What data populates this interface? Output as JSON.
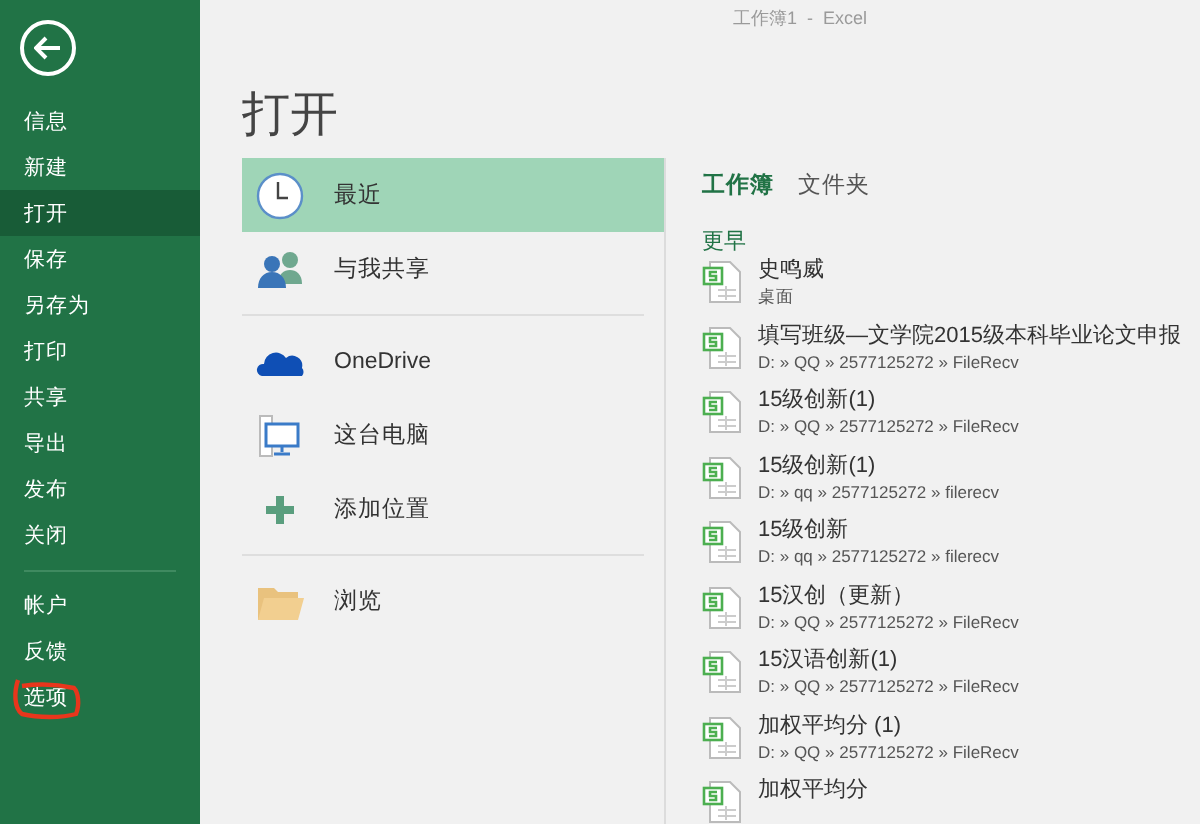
{
  "window": {
    "title": "工作簿1  -  Excel"
  },
  "sidebar": {
    "items": [
      {
        "label": "信息",
        "selected": false
      },
      {
        "label": "新建",
        "selected": false
      },
      {
        "label": "打开",
        "selected": true
      },
      {
        "label": "保存",
        "selected": false
      },
      {
        "label": "另存为",
        "selected": false
      },
      {
        "label": "打印",
        "selected": false
      },
      {
        "label": "共享",
        "selected": false
      },
      {
        "label": "导出",
        "selected": false
      },
      {
        "label": "发布",
        "selected": false
      },
      {
        "label": "关闭",
        "selected": false
      }
    ],
    "secondary_items": [
      {
        "label": "帐户",
        "selected": false,
        "circled": false
      },
      {
        "label": "反馈",
        "selected": false,
        "circled": false
      },
      {
        "label": "选项",
        "selected": false,
        "circled": true
      }
    ]
  },
  "heading": "打开",
  "locations": [
    [
      {
        "kind": "clock",
        "label": "最近",
        "selected": true
      },
      {
        "kind": "people",
        "label": "与我共享",
        "selected": false
      }
    ],
    [
      {
        "kind": "cloud",
        "label": "OneDrive",
        "selected": false
      },
      {
        "kind": "computer",
        "label": "这台电脑",
        "selected": false
      },
      {
        "kind": "plus",
        "label": "添加位置",
        "selected": false
      }
    ],
    [
      {
        "kind": "folder",
        "label": "浏览",
        "selected": false
      }
    ]
  ],
  "file_tabs": [
    {
      "label": "工作簿",
      "selected": true
    },
    {
      "label": "文件夹",
      "selected": false
    }
  ],
  "section": "更早",
  "files": [
    {
      "name": "史鸣威",
      "path": "桌面"
    },
    {
      "name": "填写班级—文学院2015级本科毕业论文申报",
      "path": "D: » QQ » 2577125272 » FileRecv"
    },
    {
      "name": "15级创新(1)",
      "path": "D: » QQ » 2577125272 » FileRecv"
    },
    {
      "name": "15级创新(1)",
      "path": "D: » qq » 2577125272 » filerecv"
    },
    {
      "name": "15级创新",
      "path": "D: » qq » 2577125272 » filerecv"
    },
    {
      "name": "15汉创（更新）",
      "path": "D: » QQ » 2577125272 » FileRecv"
    },
    {
      "name": "15汉语创新(1)",
      "path": "D: » QQ » 2577125272 » FileRecv"
    },
    {
      "name": "加权平均分 (1)",
      "path": "D: » QQ » 2577125272 » FileRecv"
    },
    {
      "name": "加权平均分"
    }
  ]
}
